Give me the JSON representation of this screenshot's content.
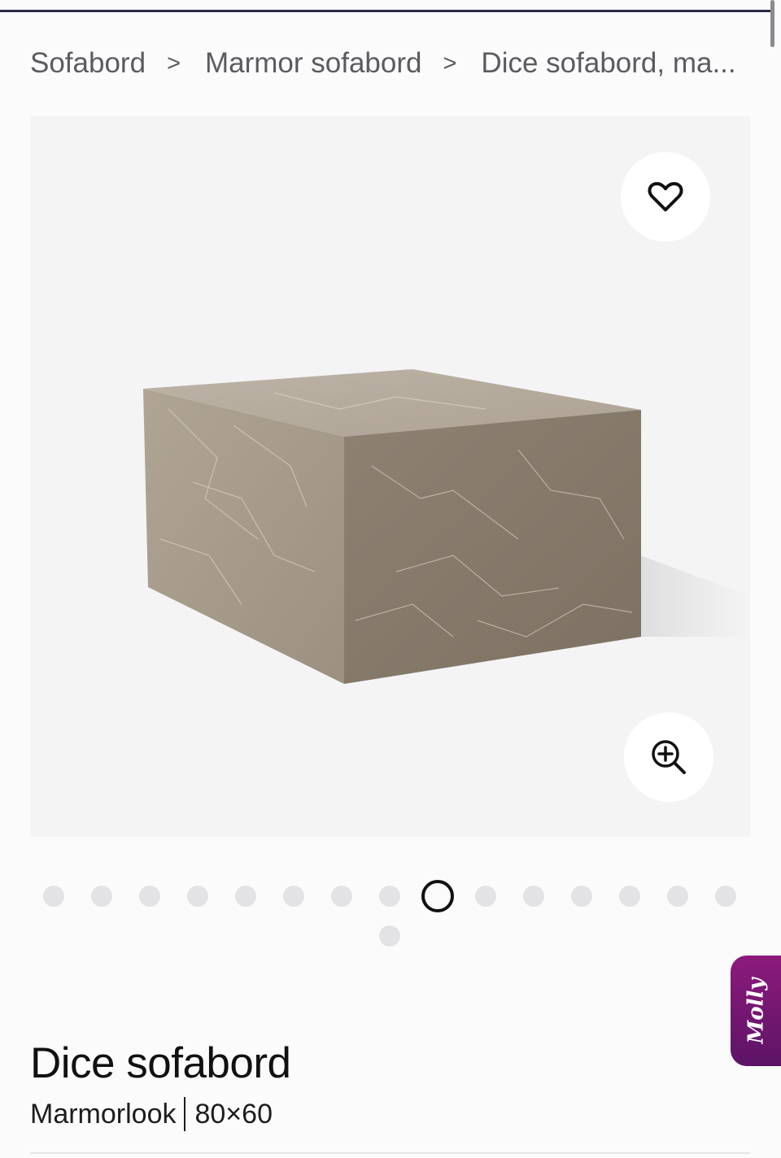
{
  "breadcrumb": {
    "items": [
      "Sofabord",
      "Marmor sofabord",
      "Dice sofabord, ma..."
    ],
    "separator": ">"
  },
  "gallery": {
    "favorite_icon": "heart-icon",
    "zoom_icon": "zoom-in-icon",
    "dot_count": 16,
    "active_dot": 8
  },
  "chat": {
    "label": "Molly",
    "color": "#7a1872"
  },
  "product": {
    "title": "Dice sofabord",
    "material": "Marmorlook",
    "size": "80×60"
  }
}
